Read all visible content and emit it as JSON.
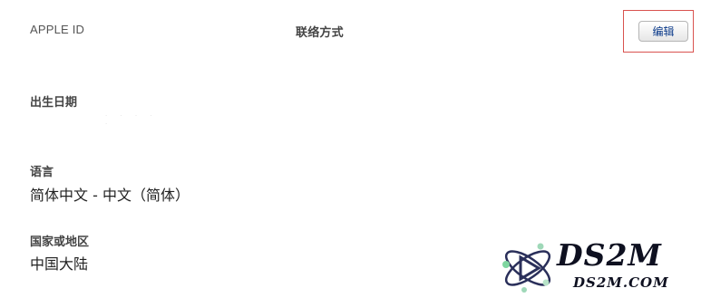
{
  "header": {
    "apple_id_label": "APPLE ID",
    "contact_label": "联络方式",
    "edit_label": "编辑"
  },
  "sections": {
    "birthday": {
      "label": "出生日期"
    },
    "language": {
      "label": "语言",
      "value": "简体中文 - 中文（简体）"
    },
    "country": {
      "label": "国家或地区",
      "value": "中国大陆"
    }
  },
  "watermark": {
    "main": "DS2M",
    "sub": "DS2M.COM"
  },
  "colors": {
    "highlight_border": "#d9534f",
    "button_text": "#0b3a8a"
  }
}
